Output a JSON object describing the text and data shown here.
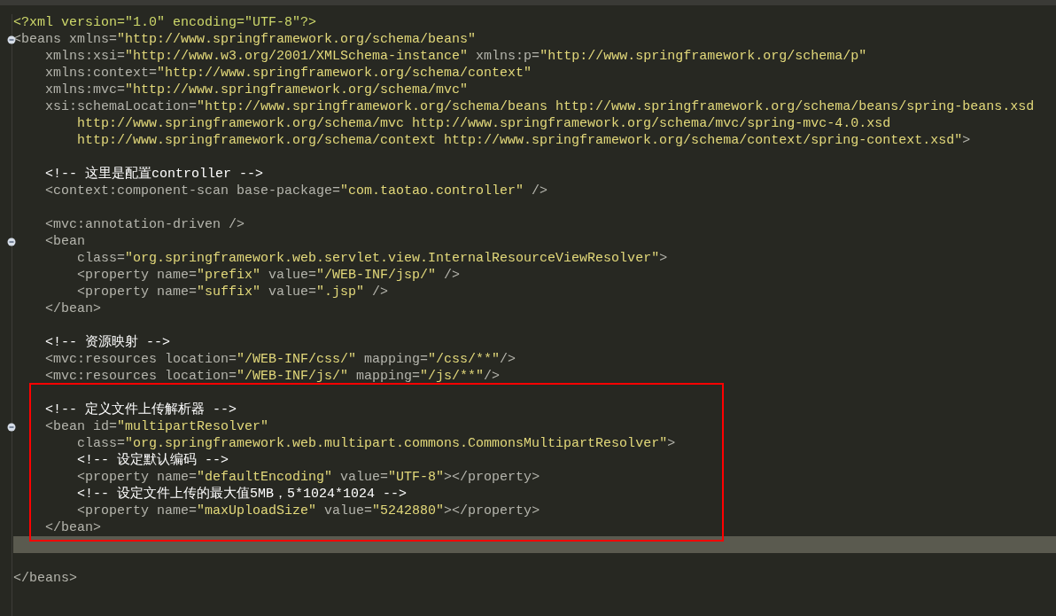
{
  "editor": {
    "lines": [
      {
        "fold": false,
        "current": false,
        "segments": [
          {
            "kind": "decl",
            "text": "<?xml version=\"1.0\" encoding=\"UTF-8\"?>"
          }
        ]
      },
      {
        "fold": true,
        "current": false,
        "segments": [
          {
            "kind": "plain",
            "text": "<beans xmlns="
          },
          {
            "kind": "string",
            "text": "\"http://www.springframework.org/schema/beans\""
          }
        ]
      },
      {
        "fold": false,
        "current": false,
        "segments": [
          {
            "kind": "plain",
            "text": "    xmlns:xsi="
          },
          {
            "kind": "string",
            "text": "\"http://www.w3.org/2001/XMLSchema-instance\""
          },
          {
            "kind": "plain",
            "text": " xmlns:p="
          },
          {
            "kind": "string",
            "text": "\"http://www.springframework.org/schema/p\""
          }
        ]
      },
      {
        "fold": false,
        "current": false,
        "segments": [
          {
            "kind": "plain",
            "text": "    xmlns:context="
          },
          {
            "kind": "string",
            "text": "\"http://www.springframework.org/schema/context\""
          }
        ]
      },
      {
        "fold": false,
        "current": false,
        "segments": [
          {
            "kind": "plain",
            "text": "    xmlns:mvc="
          },
          {
            "kind": "string",
            "text": "\"http://www.springframework.org/schema/mvc\""
          }
        ]
      },
      {
        "fold": false,
        "current": false,
        "segments": [
          {
            "kind": "plain",
            "text": "    xsi:schemaLocation="
          },
          {
            "kind": "string",
            "text": "\"http://www.springframework.org/schema/beans http://www.springframework.org/schema/beans/spring-beans.xsd"
          }
        ]
      },
      {
        "fold": false,
        "current": false,
        "segments": [
          {
            "kind": "string",
            "text": "        http://www.springframework.org/schema/mvc http://www.springframework.org/schema/mvc/spring-mvc-4.0.xsd"
          }
        ]
      },
      {
        "fold": false,
        "current": false,
        "segments": [
          {
            "kind": "string",
            "text": "        http://www.springframework.org/schema/context http://www.springframework.org/schema/context/spring-context.xsd\""
          },
          {
            "kind": "plain",
            "text": ">"
          }
        ]
      },
      {
        "fold": false,
        "current": false
      },
      {
        "fold": false,
        "current": false,
        "segments": [
          {
            "kind": "comment",
            "text": "    <!-- 这里是配置controller -->"
          }
        ]
      },
      {
        "fold": false,
        "current": false,
        "segments": [
          {
            "kind": "plain",
            "text": "    <context:component-scan base-package="
          },
          {
            "kind": "string",
            "text": "\"com.taotao.controller\""
          },
          {
            "kind": "plain",
            "text": " />"
          }
        ]
      },
      {
        "fold": false,
        "current": false
      },
      {
        "fold": false,
        "current": false,
        "segments": [
          {
            "kind": "plain",
            "text": "    <mvc:annotation-driven />"
          }
        ]
      },
      {
        "fold": true,
        "current": false,
        "segments": [
          {
            "kind": "plain",
            "text": "    <bean"
          }
        ]
      },
      {
        "fold": false,
        "current": false,
        "segments": [
          {
            "kind": "plain",
            "text": "        class="
          },
          {
            "kind": "string",
            "text": "\"org.springframework.web.servlet.view.InternalResourceViewResolver\""
          },
          {
            "kind": "plain",
            "text": ">"
          }
        ]
      },
      {
        "fold": false,
        "current": false,
        "segments": [
          {
            "kind": "plain",
            "text": "        <property name="
          },
          {
            "kind": "string",
            "text": "\"prefix\""
          },
          {
            "kind": "plain",
            "text": " value="
          },
          {
            "kind": "string",
            "text": "\"/WEB-INF/jsp/\""
          },
          {
            "kind": "plain",
            "text": " />"
          }
        ]
      },
      {
        "fold": false,
        "current": false,
        "segments": [
          {
            "kind": "plain",
            "text": "        <property name="
          },
          {
            "kind": "string",
            "text": "\"suffix\""
          },
          {
            "kind": "plain",
            "text": " value="
          },
          {
            "kind": "string",
            "text": "\".jsp\""
          },
          {
            "kind": "plain",
            "text": " />"
          }
        ]
      },
      {
        "fold": false,
        "current": false,
        "segments": [
          {
            "kind": "plain",
            "text": "    </bean>"
          }
        ]
      },
      {
        "fold": false,
        "current": false
      },
      {
        "fold": false,
        "current": false,
        "segments": [
          {
            "kind": "comment",
            "text": "    <!-- 资源映射 -->"
          }
        ]
      },
      {
        "fold": false,
        "current": false,
        "segments": [
          {
            "kind": "plain",
            "text": "    <mvc:resources location="
          },
          {
            "kind": "string",
            "text": "\"/WEB-INF/css/\""
          },
          {
            "kind": "plain",
            "text": " mapping="
          },
          {
            "kind": "string",
            "text": "\"/css/**\""
          },
          {
            "kind": "plain",
            "text": "/>"
          }
        ]
      },
      {
        "fold": false,
        "current": false,
        "segments": [
          {
            "kind": "plain",
            "text": "    <mvc:resources location="
          },
          {
            "kind": "string",
            "text": "\"/WEB-INF/js/\""
          },
          {
            "kind": "plain",
            "text": " mapping="
          },
          {
            "kind": "string",
            "text": "\"/js/**\""
          },
          {
            "kind": "plain",
            "text": "/>"
          }
        ]
      },
      {
        "fold": false,
        "current": false
      },
      {
        "fold": false,
        "current": false,
        "segments": [
          {
            "kind": "comment",
            "text": "    <!-- 定义文件上传解析器 -->"
          }
        ]
      },
      {
        "fold": true,
        "current": false,
        "segments": [
          {
            "kind": "plain",
            "text": "    <bean id="
          },
          {
            "kind": "string",
            "text": "\"multipartResolver\""
          }
        ]
      },
      {
        "fold": false,
        "current": false,
        "segments": [
          {
            "kind": "plain",
            "text": "        class="
          },
          {
            "kind": "string",
            "text": "\"org.springframework.web.multipart.commons.CommonsMultipartResolver\""
          },
          {
            "kind": "plain",
            "text": ">"
          }
        ]
      },
      {
        "fold": false,
        "current": false,
        "segments": [
          {
            "kind": "comment",
            "text": "        <!-- 设定默认编码 -->"
          }
        ]
      },
      {
        "fold": false,
        "current": false,
        "segments": [
          {
            "kind": "plain",
            "text": "        <property name="
          },
          {
            "kind": "string",
            "text": "\"defaultEncoding\""
          },
          {
            "kind": "plain",
            "text": " value="
          },
          {
            "kind": "string",
            "text": "\"UTF-8\""
          },
          {
            "kind": "plain",
            "text": "></property>"
          }
        ]
      },
      {
        "fold": false,
        "current": false,
        "segments": [
          {
            "kind": "comment",
            "text": "        <!-- 设定文件上传的最大值5MB，5*1024*1024 -->"
          }
        ]
      },
      {
        "fold": false,
        "current": false,
        "segments": [
          {
            "kind": "plain",
            "text": "        <property name="
          },
          {
            "kind": "string",
            "text": "\"maxUploadSize\""
          },
          {
            "kind": "plain",
            "text": " value="
          },
          {
            "kind": "string",
            "text": "\"5242880\""
          },
          {
            "kind": "plain",
            "text": "></property>"
          }
        ]
      },
      {
        "fold": false,
        "current": false,
        "segments": [
          {
            "kind": "plain",
            "text": "    </bean>"
          }
        ]
      },
      {
        "fold": false,
        "current": true
      },
      {
        "fold": false,
        "current": false
      },
      {
        "fold": false,
        "current": false,
        "segments": [
          {
            "kind": "plain",
            "text": "</beans>"
          }
        ]
      },
      {
        "fold": false,
        "current": false
      }
    ]
  }
}
